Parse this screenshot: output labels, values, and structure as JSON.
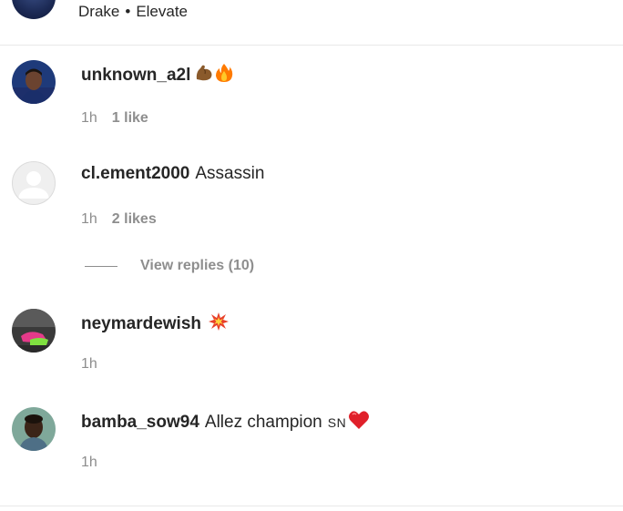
{
  "header": {
    "artist": "Drake",
    "separator": "•",
    "track": "Elevate"
  },
  "comments": [
    {
      "username": "unknown_a2l",
      "text": "",
      "emoji": [
        "flexed-biceps-icon",
        "fire-icon"
      ],
      "time": "1h",
      "likes": "1 like"
    },
    {
      "username": "cl.ement2000",
      "text": "Assassin",
      "time": "1h",
      "likes": "2 likes",
      "replies": "View replies (10)"
    },
    {
      "username": "neymardewish",
      "text": "",
      "emoji": [
        "collision-icon"
      ],
      "time": "1h"
    },
    {
      "username": "bamba_sow94",
      "text": "Allez champion",
      "flag_text": "SN",
      "emoji": [
        "red-heart-icon"
      ],
      "time": "1h"
    }
  ],
  "colors": {
    "text": "#262626",
    "secondary": "#8e8e8e",
    "divider": "#e8e8e8",
    "heart": "#e0202a",
    "fire": "#ff7a00",
    "biceps": "#8a5a2b"
  }
}
